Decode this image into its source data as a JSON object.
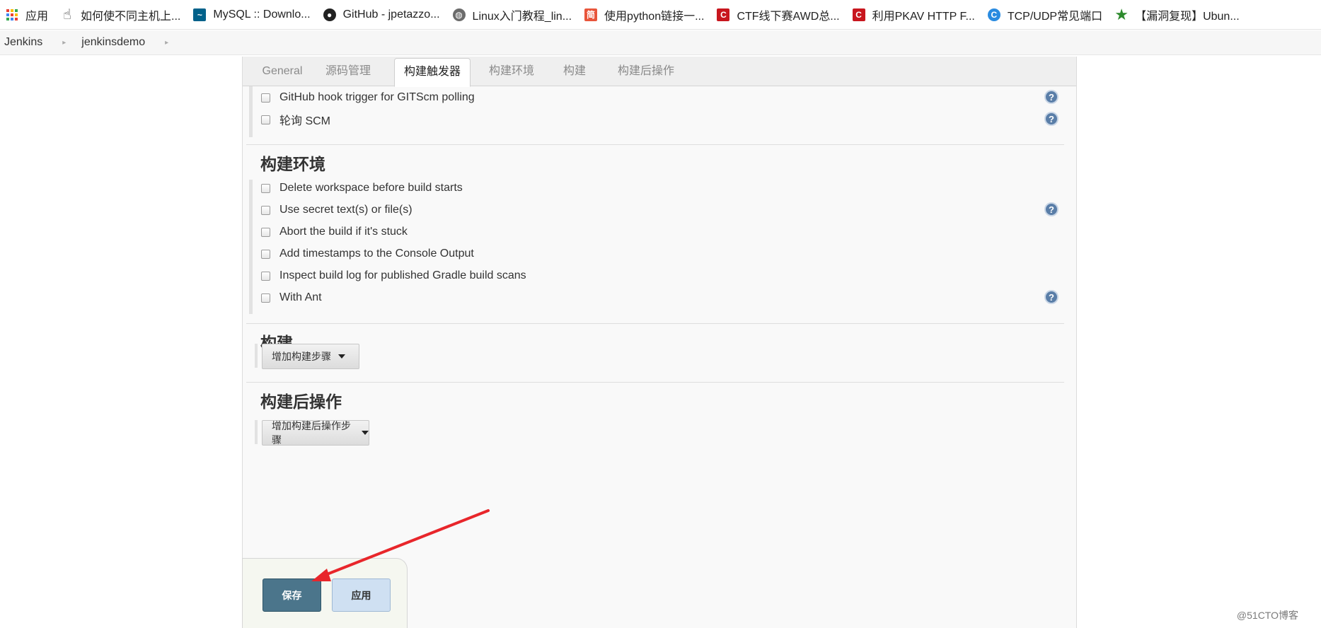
{
  "bookmarks": [
    {
      "label": "应用",
      "icon": "apps-icon"
    },
    {
      "label": "如何使不同主机上...",
      "icon": "hand-icon"
    },
    {
      "label": "MySQL :: Downlo...",
      "icon": "mysql-icon"
    },
    {
      "label": "GitHub - jpetazzo...",
      "icon": "github-icon"
    },
    {
      "label": "Linux入门教程_lin...",
      "icon": "globe-icon"
    },
    {
      "label": "使用python链接一...",
      "icon": "jianshu-icon",
      "glyph": "简"
    },
    {
      "label": "CTF线下赛AWD总...",
      "icon": "csdn-icon",
      "glyph": "C"
    },
    {
      "label": "利用PKAV HTTP F...",
      "icon": "csdn-icon",
      "glyph": "C"
    },
    {
      "label": "TCP/UDP常见端口",
      "icon": "c-blue-icon",
      "glyph": "C"
    },
    {
      "label": "【漏洞复现】Ubun...",
      "icon": "star-icon",
      "glyph": "★"
    }
  ],
  "breadcrumb": {
    "items": [
      "Jenkins",
      "jenkinsdemo"
    ],
    "separator": "▸"
  },
  "tabs": [
    "General",
    "源码管理",
    "构建触发器",
    "构建环境",
    "构建",
    "构建后操作"
  ],
  "active_tab": "构建触发器",
  "triggers": {
    "options": [
      {
        "label": "GitHub hook trigger for GITScm polling",
        "checked": false,
        "help": true
      },
      {
        "label": "轮询 SCM",
        "checked": false,
        "help": true
      }
    ]
  },
  "build_env": {
    "title": "构建环境",
    "options": [
      {
        "label": "Delete workspace before build starts",
        "checked": false,
        "help": false
      },
      {
        "label": "Use secret text(s) or file(s)",
        "checked": false,
        "help": true
      },
      {
        "label": "Abort the build if it's stuck",
        "checked": false,
        "help": false
      },
      {
        "label": "Add timestamps to the Console Output",
        "checked": false,
        "help": false
      },
      {
        "label": "Inspect build log for published Gradle build scans",
        "checked": false,
        "help": false
      },
      {
        "label": "With Ant",
        "checked": false,
        "help": true
      }
    ]
  },
  "build": {
    "title": "构建",
    "add_step_label": "增加构建步骤"
  },
  "post_build": {
    "title": "构建后操作",
    "add_step_label": "增加构建后操作步骤"
  },
  "buttons": {
    "save_label": "保存",
    "apply_label": "应用"
  },
  "help_glyph": "?",
  "watermark": "@51CTO博客",
  "colors": {
    "save_button": "#4b758b",
    "apply_button": "#cfe0f2",
    "help_icon": "#5a7ea8",
    "annotation_arrow": "#e8262b"
  }
}
